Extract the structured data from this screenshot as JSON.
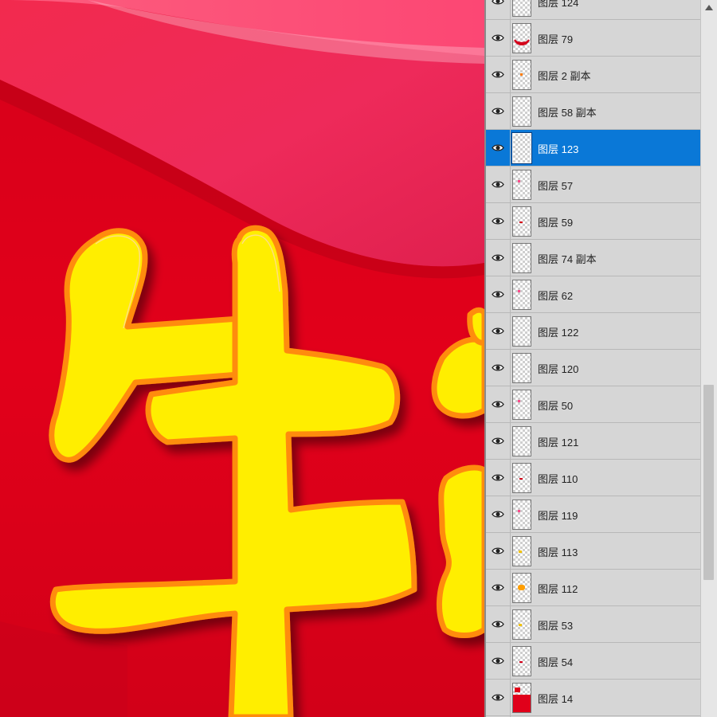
{
  "canvas": {
    "glyph_char": "生",
    "colors": {
      "background": "#e00018",
      "ribbon": "#f0305a",
      "glyph_fill": "#fff000",
      "glyph_outline": "#ff9d1a"
    }
  },
  "layers_panel": {
    "scroll_up_icon": "triangle-up-icon",
    "scroll_position": 0.73,
    "layers": [
      {
        "name": "图层 124",
        "visible": true,
        "selected": false,
        "thumb": "empty"
      },
      {
        "name": "图层 79",
        "visible": true,
        "selected": false,
        "thumb": "red-curve"
      },
      {
        "name": "图层 2 副本",
        "visible": true,
        "selected": false,
        "thumb": "dot-orange"
      },
      {
        "name": "图层 58 副本",
        "visible": true,
        "selected": false,
        "thumb": "empty"
      },
      {
        "name": "图层 123",
        "visible": true,
        "selected": true,
        "thumb": "empty"
      },
      {
        "name": "图层 57",
        "visible": true,
        "selected": false,
        "thumb": "dot-pink"
      },
      {
        "name": "图层 59",
        "visible": true,
        "selected": false,
        "thumb": "dot-red"
      },
      {
        "name": "图层 74 副本",
        "visible": true,
        "selected": false,
        "thumb": "empty"
      },
      {
        "name": "图层 62",
        "visible": true,
        "selected": false,
        "thumb": "dot-pink"
      },
      {
        "name": "图层 122",
        "visible": true,
        "selected": false,
        "thumb": "empty"
      },
      {
        "name": "图层 120",
        "visible": true,
        "selected": false,
        "thumb": "empty"
      },
      {
        "name": "图层 50",
        "visible": true,
        "selected": false,
        "thumb": "dot-pink"
      },
      {
        "name": "图层 121",
        "visible": true,
        "selected": false,
        "thumb": "empty"
      },
      {
        "name": "图层 110",
        "visible": true,
        "selected": false,
        "thumb": "dot-red"
      },
      {
        "name": "图层 119",
        "visible": true,
        "selected": false,
        "thumb": "dot-pink"
      },
      {
        "name": "图层 113",
        "visible": true,
        "selected": false,
        "thumb": "dot-yellow"
      },
      {
        "name": "图层 112",
        "visible": true,
        "selected": false,
        "thumb": "dot-orange-large"
      },
      {
        "name": "图层 53",
        "visible": true,
        "selected": false,
        "thumb": "dot-yellow"
      },
      {
        "name": "图层 54",
        "visible": true,
        "selected": false,
        "thumb": "dot-red"
      },
      {
        "name": "图层 14",
        "visible": true,
        "selected": false,
        "thumb": "red-fill"
      },
      {
        "name": "",
        "visible": true,
        "selected": false,
        "thumb": "empty"
      }
    ]
  }
}
